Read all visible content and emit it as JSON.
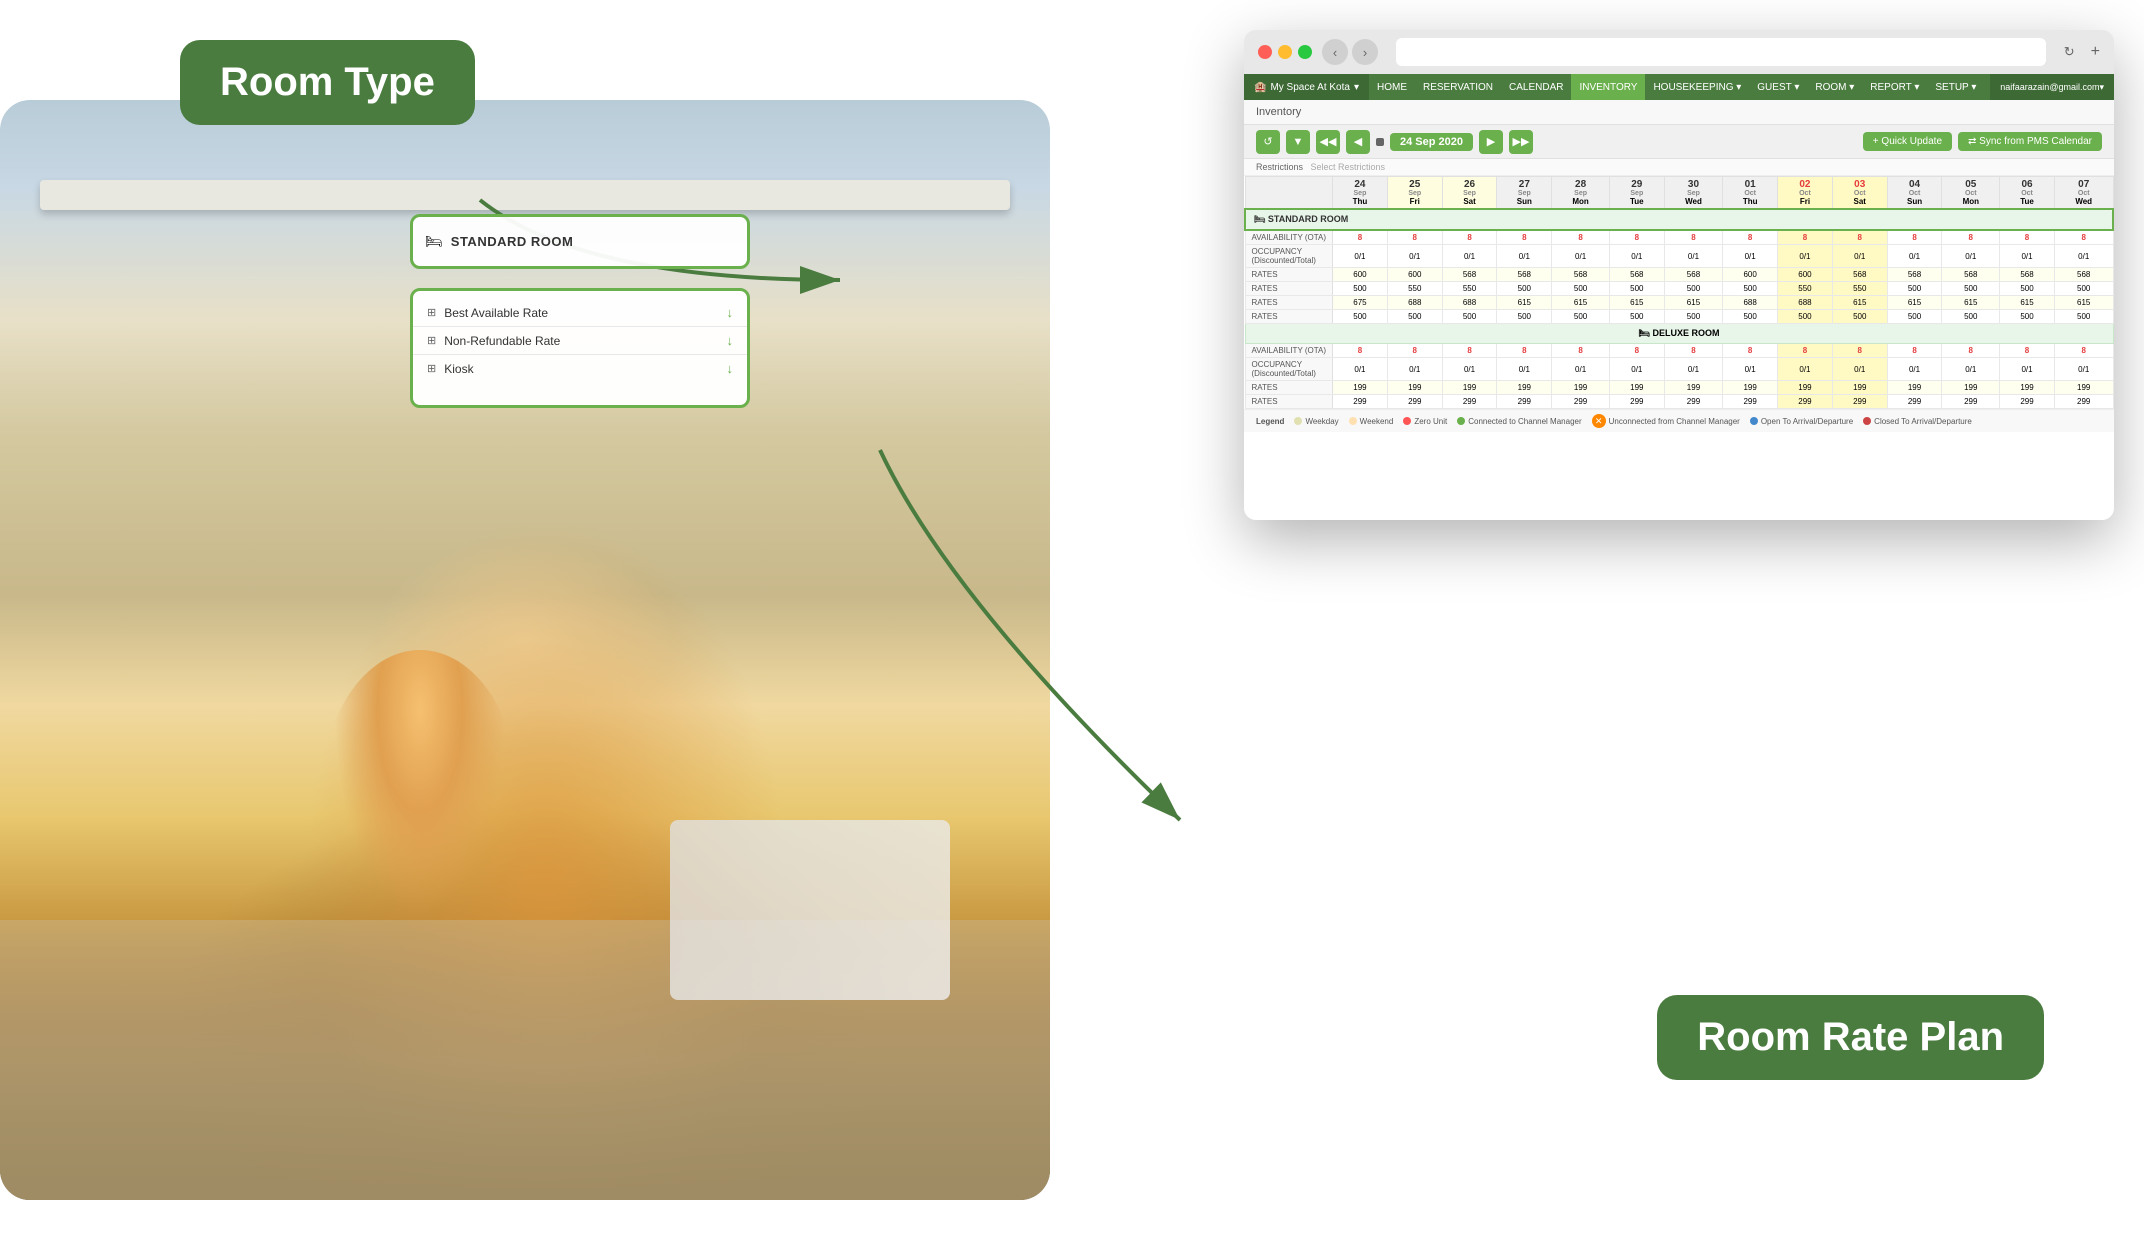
{
  "callouts": {
    "room_type_label": "Room Type",
    "room_rate_plan_label": "Room Rate Plan"
  },
  "browser": {
    "title": "",
    "nav_back": "‹",
    "nav_forward": "›",
    "refresh": "↻",
    "new_tab": "+"
  },
  "app": {
    "brand": "My Space At Kota",
    "email": "naifaarazain@gmail.com",
    "menu_items": [
      "HOME",
      "RESERVATION",
      "CALENDAR",
      "INVENTORY",
      "HOUSEKEEPING",
      "GUEST",
      "ROOM",
      "REPORT",
      "SETUP"
    ],
    "page_title": "Inventory",
    "date": "24 Sep 2020",
    "btn_quick_update": "+ Quick Update",
    "btn_sync": "⇄ Sync from PMS Calendar",
    "restrictions_label": "Restrictions",
    "restrictions_placeholder": "Select Restrictions"
  },
  "room_type": {
    "icon": "🛏",
    "name": "STANDARD ROOM"
  },
  "rate_plans": [
    {
      "icon": "⊞",
      "name": "Best Available Rate",
      "arrow": "↓"
    },
    {
      "icon": "⊞",
      "name": "Non-Refundable Rate",
      "arrow": "↓"
    },
    {
      "icon": "⊞",
      "name": "Kiosk",
      "arrow": "↓"
    }
  ],
  "table": {
    "dates": [
      {
        "day": "Thu",
        "num": "24",
        "month": "Sep"
      },
      {
        "day": "Fri",
        "num": "25",
        "month": "Sep"
      },
      {
        "day": "Sat",
        "num": "26",
        "month": "Sep"
      },
      {
        "day": "Sun",
        "num": "27",
        "month": "Sep"
      },
      {
        "day": "Mon",
        "num": "28",
        "month": "Sep"
      },
      {
        "day": "Tue",
        "num": "29",
        "month": "Sep"
      },
      {
        "day": "Wed",
        "num": "30",
        "month": "Sep"
      },
      {
        "day": "Thu",
        "num": "01",
        "month": "Oct"
      },
      {
        "day": "Fri",
        "num": "02",
        "month": "Oct"
      },
      {
        "day": "Sat",
        "num": "03",
        "month": "Oct"
      },
      {
        "day": "Sun",
        "num": "04",
        "month": "Oct"
      },
      {
        "day": "Mon",
        "num": "05",
        "month": "Oct"
      },
      {
        "day": "Tue",
        "num": "06",
        "month": "Oct"
      },
      {
        "day": "Wed",
        "num": "07",
        "month": "Oct"
      }
    ],
    "row_labels": [
      "AVAILABILITY (OTA)",
      "OCCUPANCY\n(Discounted/Total)",
      "RATES",
      "RATES",
      "RATES",
      "RATES",
      "AVAILABILITY (OTA)",
      "OCCUPANCY\n(Discounted/Total)",
      "RATES",
      "RATES"
    ]
  },
  "legend": {
    "items": [
      {
        "color": "#e0e0b0",
        "label": "Weekday"
      },
      {
        "color": "#ffe0b0",
        "label": "Weekend"
      },
      {
        "color": "#ff5555",
        "label": "Zero Unit"
      },
      {
        "color": "#6ab04c",
        "label": "Connected to Channel Manager"
      },
      {
        "color": "#ff8800",
        "label": "Unconnected from Channel Manager"
      },
      {
        "color": "#4488cc",
        "label": "Open To Arrival/Departure"
      },
      {
        "color": "#cc4444",
        "label": "Closed To Arrival/Departure"
      }
    ]
  }
}
